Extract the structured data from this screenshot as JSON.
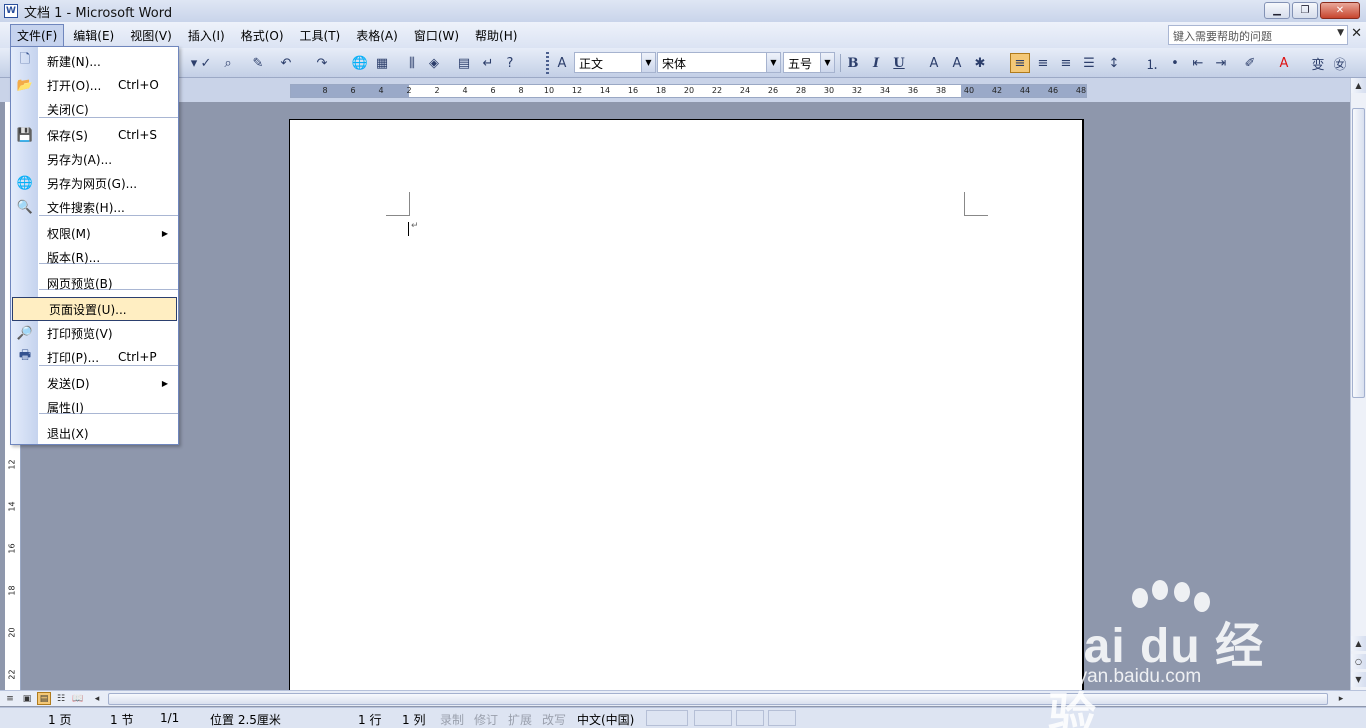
{
  "window": {
    "title": "文档 1 - Microsoft Word",
    "min_glyph": "▁",
    "restore_glyph": "❐",
    "close_glyph": "✕"
  },
  "menubar": {
    "items": [
      "文件(F)",
      "编辑(E)",
      "视图(V)",
      "插入(I)",
      "格式(O)",
      "工具(T)",
      "表格(A)",
      "窗口(W)",
      "帮助(H)"
    ],
    "help_placeholder": "键入需要帮助的问题",
    "close_doc": "✕"
  },
  "toolbar": {
    "style_value": "正文",
    "font_value": "宋体",
    "size_value": "五号",
    "bold": "B",
    "italic": "I",
    "underline": "U"
  },
  "ruler": {
    "h_ticks": [
      "8",
      "6",
      "4",
      "2",
      "2",
      "4",
      "6",
      "8",
      "10",
      "12",
      "14",
      "16",
      "18",
      "20",
      "22",
      "24",
      "26",
      "28",
      "30",
      "32",
      "34",
      "36",
      "38",
      "40",
      "42",
      "44",
      "46",
      "48"
    ],
    "v_ticks": [
      "12",
      "14",
      "16",
      "18",
      "20",
      "22"
    ]
  },
  "file_menu": {
    "items": [
      {
        "label": "新建(N)...",
        "shortcut": "",
        "icon": "new-doc-icon",
        "glyph": "🗋"
      },
      {
        "label": "打开(O)...",
        "shortcut": "Ctrl+O",
        "icon": "open-folder-icon",
        "glyph": "📂"
      },
      {
        "label": "关闭(C)",
        "shortcut": "",
        "icon": "",
        "glyph": ""
      },
      {
        "label": "保存(S)",
        "shortcut": "Ctrl+S",
        "icon": "save-icon",
        "glyph": "💾"
      },
      {
        "label": "另存为(A)...",
        "shortcut": "",
        "icon": "",
        "glyph": ""
      },
      {
        "label": "另存为网页(G)...",
        "shortcut": "",
        "icon": "save-web-icon",
        "glyph": "🌐"
      },
      {
        "label": "文件搜索(H)...",
        "shortcut": "",
        "icon": "file-search-icon",
        "glyph": "🔍"
      },
      {
        "label": "权限(M)",
        "shortcut": "",
        "icon": "",
        "glyph": "",
        "submenu": true
      },
      {
        "label": "版本(R)...",
        "shortcut": "",
        "icon": "",
        "glyph": ""
      },
      {
        "label": "网页预览(B)",
        "shortcut": "",
        "icon": "",
        "glyph": ""
      },
      {
        "label": "页面设置(U)...",
        "shortcut": "",
        "icon": "",
        "glyph": "",
        "highlighted": true
      },
      {
        "label": "打印预览(V)",
        "shortcut": "",
        "icon": "print-preview-icon",
        "glyph": "🔎"
      },
      {
        "label": "打印(P)...",
        "shortcut": "Ctrl+P",
        "icon": "printer-icon",
        "glyph": "🖶"
      },
      {
        "label": "发送(D)",
        "shortcut": "",
        "icon": "",
        "glyph": "",
        "submenu": true
      },
      {
        "label": "属性(I)",
        "shortcut": "",
        "icon": "",
        "glyph": ""
      },
      {
        "label": "退出(X)",
        "shortcut": "",
        "icon": "",
        "glyph": ""
      }
    ]
  },
  "statusbar": {
    "page": "1 页",
    "section": "1 节",
    "page_of": "1/1",
    "position": "位置 2.5厘米",
    "line": "1 行",
    "column": "1 列",
    "rec": "录制",
    "trk": "修订",
    "ext": "扩展",
    "ovr": "改写",
    "language": "中文(中国)"
  },
  "watermark": {
    "text": "Bai du 经验",
    "url": "jingyan.baidu.com"
  },
  "colors": {
    "accent": "#f4c877",
    "workspace": "#8e97ac",
    "menu_highlight": "#ffeec2"
  }
}
